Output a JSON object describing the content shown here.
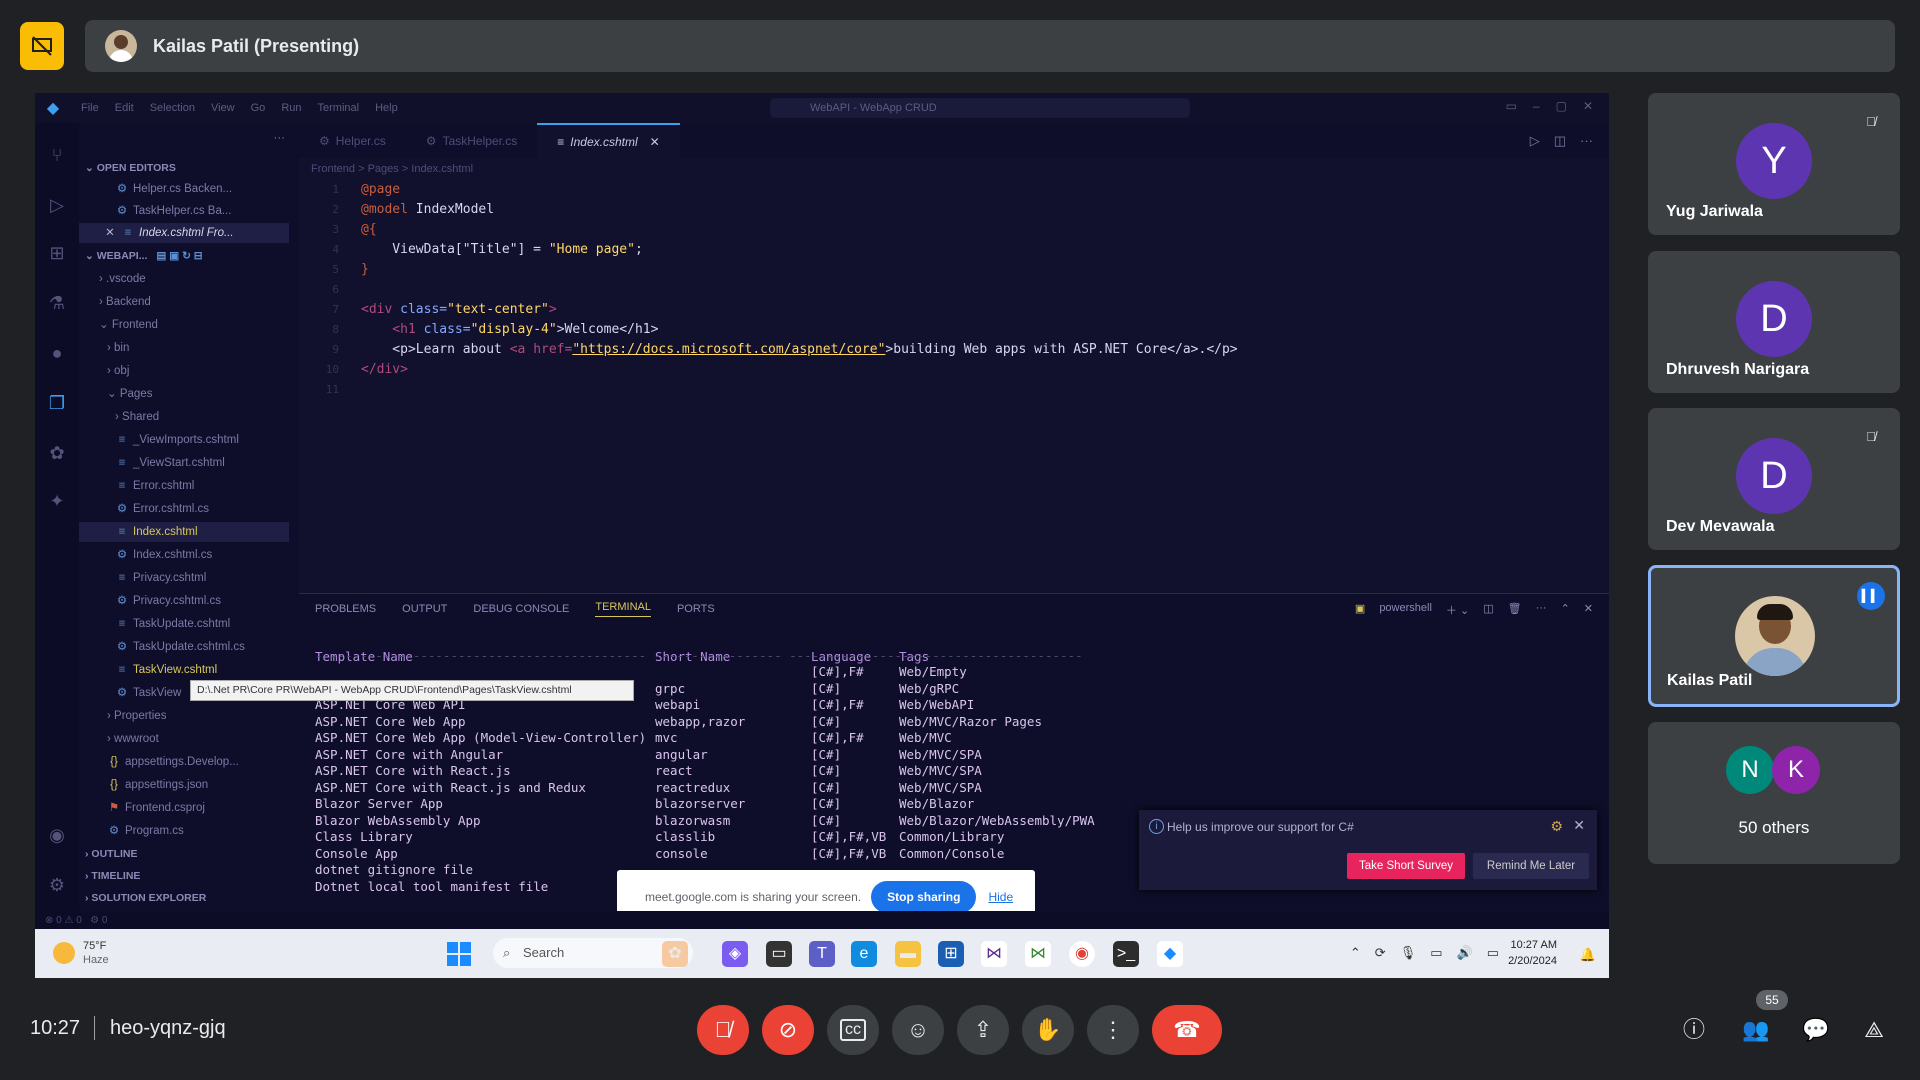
{
  "presenter_bar": {
    "name": "Kailas Patil (Presenting)"
  },
  "vscode": {
    "menu": [
      "File",
      "Edit",
      "Selection",
      "View",
      "Go",
      "Run",
      "Terminal",
      "Help"
    ],
    "search_placeholder": "WebAPI - WebApp CRUD",
    "tabs": [
      "Helper.cs",
      "TaskHelper.cs",
      "Index.cshtml"
    ],
    "breadcrumb": "Frontend > Pages > Index.cshtml",
    "explorer": {
      "open_editors_label": "OPEN EDITORS",
      "open_editors": [
        "Helper.cs Backen...",
        "TaskHelper.cs Ba...",
        "Index.cshtml Fro..."
      ],
      "project_label": "WEBAPI...",
      "items": [
        ".vscode",
        "Backend",
        "Frontend",
        "bin",
        "obj",
        "Pages",
        "Shared",
        "_ViewImports.cshtml",
        "_ViewStart.cshtml",
        "Error.cshtml",
        "Error.cshtml.cs",
        "Index.cshtml",
        "Index.cshtml.cs",
        "Privacy.cshtml",
        "Privacy.cshtml.cs",
        "TaskUpdate.cshtml",
        "TaskUpdate.cshtml.cs",
        "TaskView.cshtml",
        "TaskView",
        "Properties",
        "wwwroot",
        "appsettings.Develop...",
        "appsettings.json",
        "Frontend.csproj",
        "Program.cs"
      ],
      "sections": [
        "OUTLINE",
        "TIMELINE",
        "SOLUTION EXPLORER"
      ]
    },
    "code": {
      "line1": "@page",
      "line2_kw": "@model",
      "line2_rest": " IndexModel",
      "line3": "@{",
      "line4_a": "    ViewData[\"Title\"] = ",
      "line4_b": "\"Home page\"",
      "line4_c": ";",
      "line5": "}",
      "line7_a": "<div",
      "line7_b": " class=",
      "line7_c": "\"text-center\"",
      "line7_d": ">",
      "line8_a": "    <h1",
      "line8_b": " class=",
      "line8_c": "\"display-4\"",
      "line8_d": ">Welcome</h1>",
      "line9_a": "    <p>Learn about ",
      "line9_b": "<a href=",
      "line9_c": "\"https://docs.microsoft.com/aspnet/core\"",
      "line9_d": ">building Web apps with ASP.NET Core</a>.</p>",
      "line10": "</div>"
    },
    "panel_tabs": [
      "PROBLEMS",
      "OUTPUT",
      "DEBUG CONSOLE",
      "TERMINAL",
      "PORTS"
    ],
    "terminal_shell": "powershell",
    "terminal_headers": [
      "Template Name",
      "Short Name",
      "Language",
      "Tags"
    ],
    "terminal_rows": [
      [
        "",
        "",
        "[C#],F#",
        "Web/Empty"
      ],
      [
        "",
        "grpc",
        "[C#]",
        "Web/gRPC"
      ],
      [
        "ASP.NET Core Web API",
        "webapi",
        "[C#],F#",
        "Web/WebAPI"
      ],
      [
        "ASP.NET Core Web App",
        "webapp,razor",
        "[C#]",
        "Web/MVC/Razor Pages"
      ],
      [
        "ASP.NET Core Web App (Model-View-Controller)",
        "mvc",
        "[C#],F#",
        "Web/MVC"
      ],
      [
        "ASP.NET Core with Angular",
        "angular",
        "[C#]",
        "Web/MVC/SPA"
      ],
      [
        "ASP.NET Core with React.js",
        "react",
        "[C#]",
        "Web/MVC/SPA"
      ],
      [
        "ASP.NET Core with React.js and Redux",
        "reactredux",
        "[C#]",
        "Web/MVC/SPA"
      ],
      [
        "Blazor Server App",
        "blazorserver",
        "[C#]",
        "Web/Blazor"
      ],
      [
        "Blazor WebAssembly App",
        "blazorwasm",
        "[C#]",
        "Web/Blazor/WebAssembly/PWA"
      ],
      [
        "Class Library",
        "classlib",
        "[C#],F#,VB",
        "Common/Library"
      ],
      [
        "Console App",
        "console",
        "[C#],F#,VB",
        "Common/Console"
      ],
      [
        "dotnet gitignore file",
        "",
        "",
        ""
      ],
      [
        "Dotnet local tool manifest file",
        "",
        "",
        ""
      ]
    ],
    "tooltip": "D:\\.Net PR\\Core PR\\WebAPI - WebApp CRUD\\Frontend\\Pages\\TaskView.cshtml",
    "survey": {
      "text": "Help us improve our support for C#",
      "take": "Take Short Survey",
      "remind": "Remind Me Later"
    }
  },
  "share_bar": {
    "text": "meet.google.com is sharing your screen.",
    "stop": "Stop sharing",
    "hide": "Hide"
  },
  "taskbar": {
    "temp": "75°F",
    "cond": "Haze",
    "search": "Search",
    "time": "10:27 AM",
    "date": "2/20/2024"
  },
  "participants": [
    {
      "initial": "Y",
      "name": "Yug Jariwala",
      "color": "#5e35b1"
    },
    {
      "initial": "D",
      "name": "Dhruvesh Narigara",
      "color": "#5e35b1"
    },
    {
      "initial": "D",
      "name": "Dev Mevawala",
      "color": "#5e35b1"
    },
    {
      "name": "Kailas Patil"
    }
  ],
  "others": {
    "a": "N",
    "b": "K",
    "label": "50 others"
  },
  "bottom_bar": {
    "time": "10:27",
    "code": "heo-yqnz-gjq",
    "people_count": "55"
  },
  "colors": {
    "meet_bg": "#202124",
    "tile_bg": "#3c4043",
    "red": "#ea4335",
    "accent": "#8ab4f8",
    "present_yellow": "#fbbc04"
  }
}
